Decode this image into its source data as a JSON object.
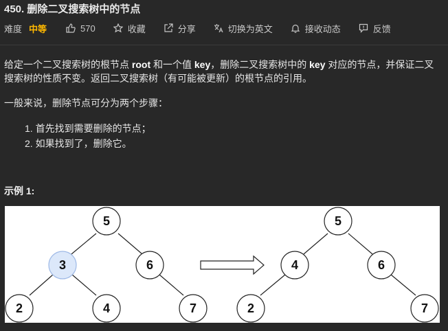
{
  "header": {
    "title": "450. 删除二叉搜索树中的节点"
  },
  "meta": {
    "difficulty_label": "难度",
    "difficulty_value": "中等",
    "likes": "570",
    "favorite": "收藏",
    "share": "分享",
    "translate": "切换为英文",
    "subscribe": "接收动态",
    "feedback": "反馈"
  },
  "colors": {
    "background": "#282828",
    "difficulty": "#ffb800",
    "highlight_node_fill": "#dce8fa",
    "highlight_node_stroke": "#9db8e6"
  },
  "description": {
    "p1_a": "给定一个二叉搜索树的根节点 ",
    "p1_b": "root",
    "p1_c": " 和一个值 ",
    "p1_d": "key",
    "p1_e": "，删除二叉搜索树中的 ",
    "p1_f": "key",
    "p1_g": " 对应的节点，并保证二叉搜索树的性质不变。返回二叉搜索树（有可能被更新）的根节点的引用。",
    "p2": "一般来说，删除节点可分为两个步骤：",
    "steps": [
      "1. 首先找到需要删除的节点；",
      "2. 如果找到了，删除它。"
    ]
  },
  "example": {
    "label": "示例 1:",
    "before_tree": [
      "5",
      "3",
      "6",
      "2",
      "4",
      "7"
    ],
    "after_tree": [
      "5",
      "4",
      "6",
      "2",
      "7"
    ]
  },
  "icons": [
    "thumbs-up-icon",
    "star-icon",
    "share-icon",
    "translate-icon",
    "bell-icon",
    "feedback-icon",
    "right-arrow-icon"
  ]
}
